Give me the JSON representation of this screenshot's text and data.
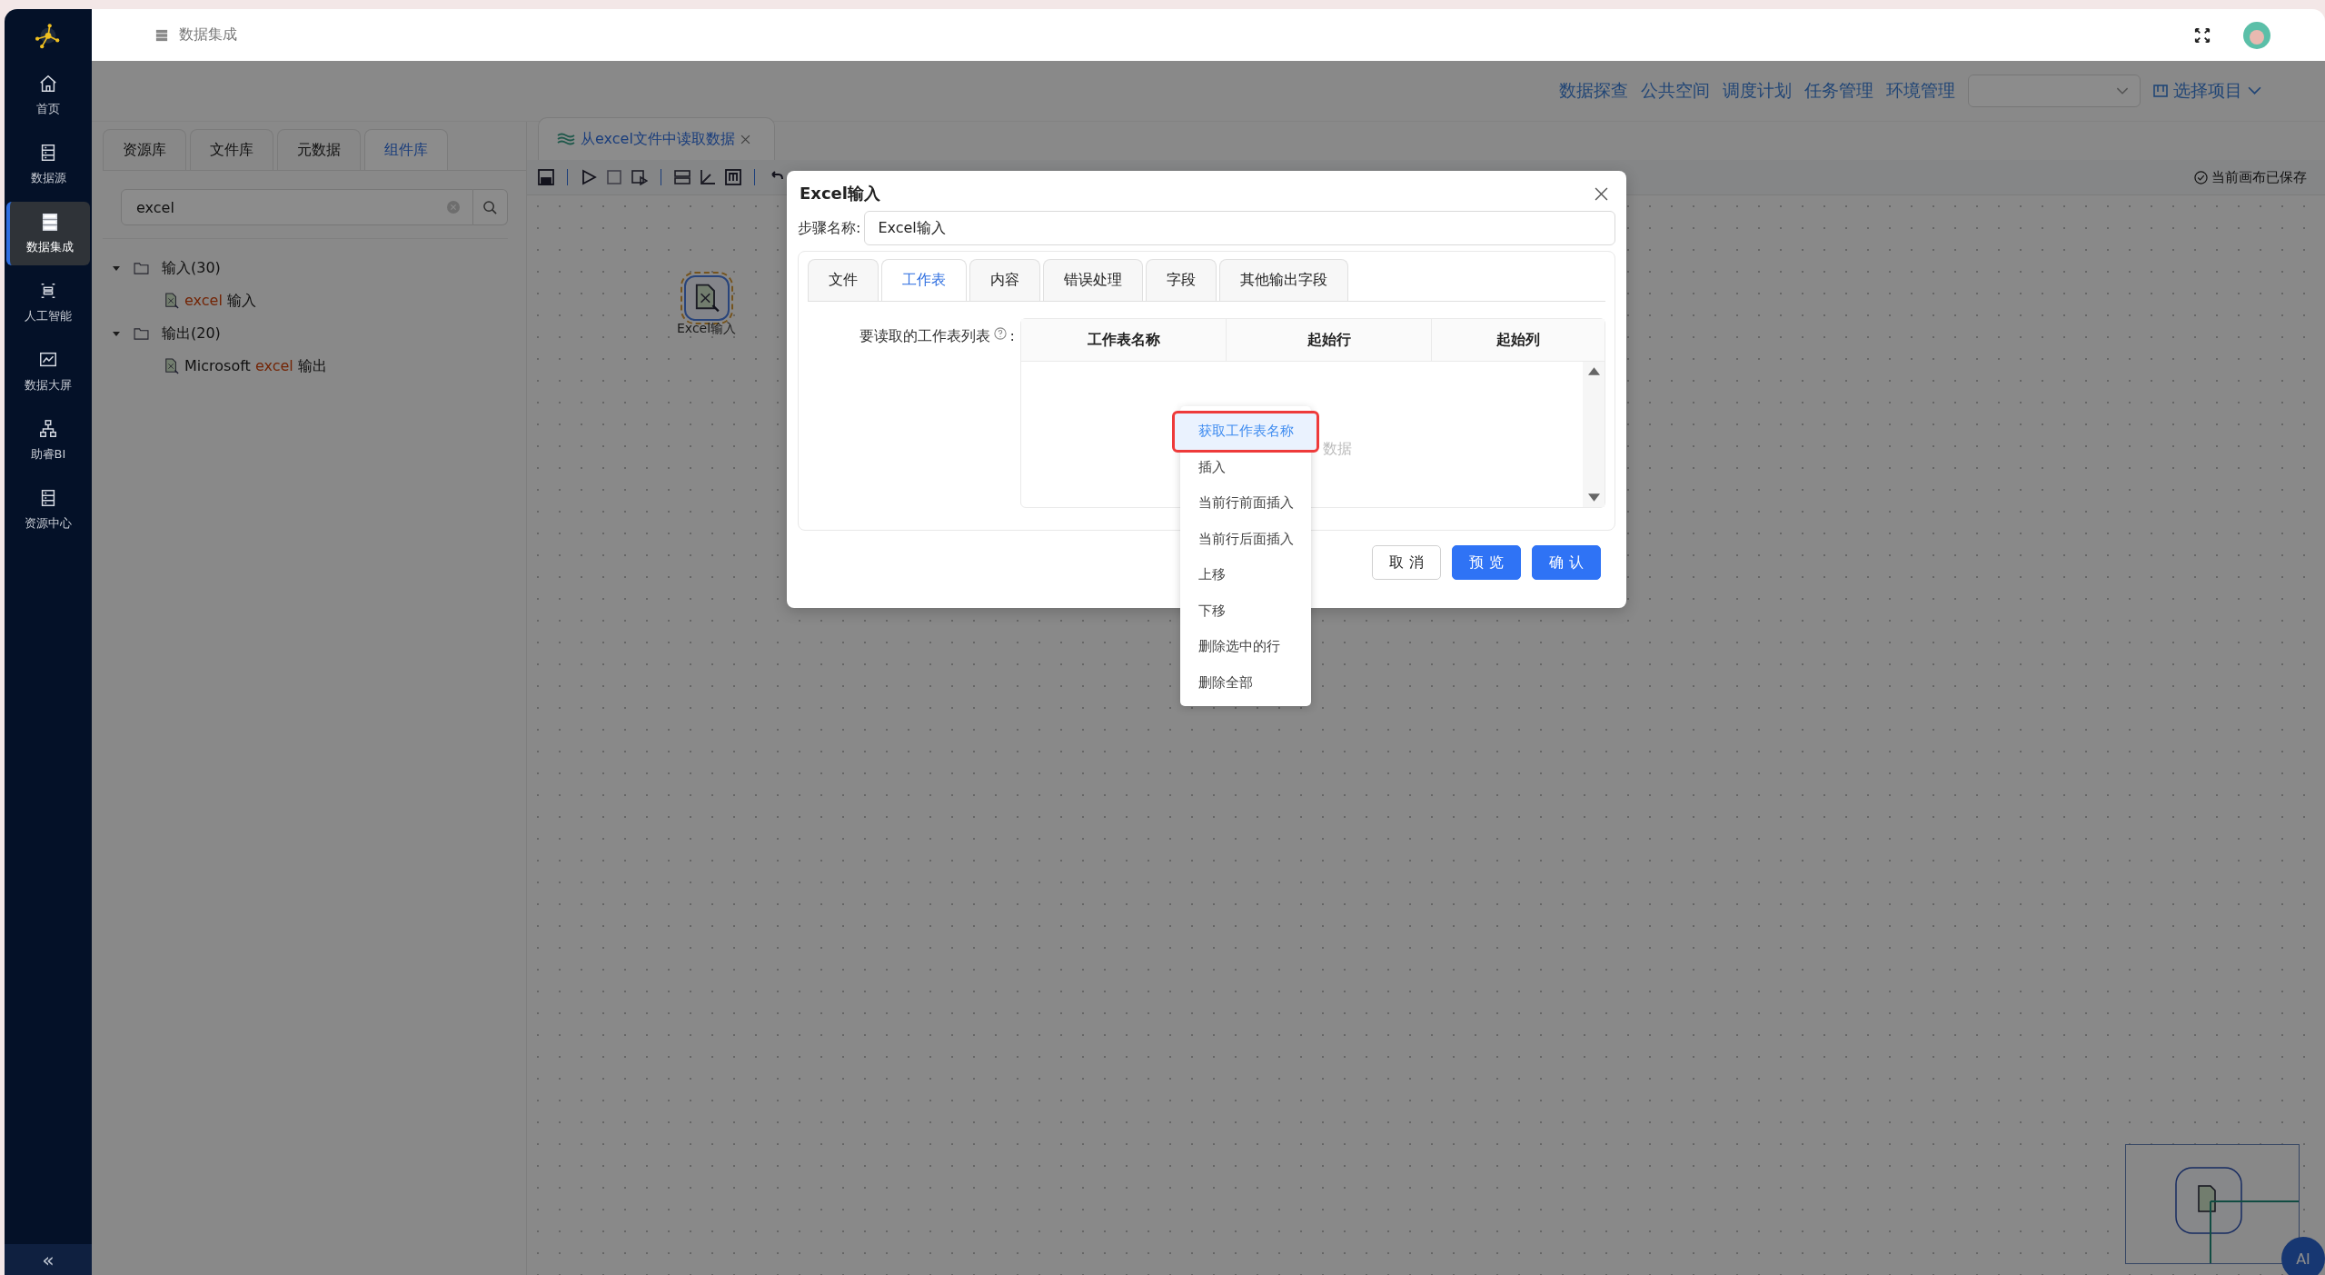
{
  "sidebar": {
    "items": [
      {
        "label": "首页",
        "selected": false
      },
      {
        "label": "数据源",
        "selected": false
      },
      {
        "label": "数据集成",
        "selected": true
      },
      {
        "label": "人工智能",
        "selected": false
      },
      {
        "label": "数据大屏",
        "selected": false
      },
      {
        "label": "助睿BI",
        "selected": false
      },
      {
        "label": "资源中心",
        "selected": false
      }
    ],
    "collapse": "«"
  },
  "header": {
    "breadcrumb": "数据集成"
  },
  "nav": {
    "links": [
      "数据探查",
      "公共空间",
      "调度计划",
      "任务管理",
      "环境管理"
    ],
    "project_select": "选择项目"
  },
  "left_panel": {
    "tabs": [
      {
        "label": "资源库",
        "selected": false
      },
      {
        "label": "文件库",
        "selected": false
      },
      {
        "label": "元数据",
        "selected": false
      },
      {
        "label": "组件库",
        "selected": true
      }
    ],
    "search": {
      "value": "excel"
    },
    "tree": [
      {
        "label": "输入(30)",
        "expanded": true,
        "children": [
          {
            "match": "excel",
            "after": " 输入"
          }
        ]
      },
      {
        "label": "输出(20)",
        "expanded": true,
        "children": [
          {
            "before": "Microsoft ",
            "match": "excel",
            "after": " 输出"
          }
        ]
      }
    ]
  },
  "editor": {
    "tab": "从excel文件中读取数据",
    "status": "当前画布已保存",
    "node": {
      "label": "Excel输入",
      "selected": true
    },
    "ai_button": "AI"
  },
  "modal": {
    "title": "Excel输入",
    "step_label": "步骤名称:",
    "step_value": "Excel输入",
    "tabs": [
      {
        "label": "文件",
        "selected": false
      },
      {
        "label": "工作表",
        "selected": true
      },
      {
        "label": "内容",
        "selected": false
      },
      {
        "label": "错误处理",
        "selected": false
      },
      {
        "label": "字段",
        "selected": false
      },
      {
        "label": "其他输出字段",
        "selected": false
      }
    ],
    "field_label": "要读取的工作表列表",
    "field_colon": ":",
    "table": {
      "columns": [
        "工作表名称",
        "起始行",
        "起始列"
      ],
      "empty_text": "数据"
    },
    "buttons": [
      {
        "label": "取 消",
        "kind": "default"
      },
      {
        "label": "预 览",
        "kind": "primary"
      },
      {
        "label": "确 认",
        "kind": "primary"
      }
    ]
  },
  "context_menu": {
    "items": [
      {
        "label": "获取工作表名称",
        "selected": true,
        "annotated": true
      },
      {
        "label": "插入",
        "selected": false,
        "annotated": false
      },
      {
        "label": "当前行前面插入",
        "selected": false,
        "annotated": false
      },
      {
        "label": "当前行后面插入",
        "selected": false,
        "annotated": false
      },
      {
        "label": "上移",
        "selected": false,
        "annotated": false
      },
      {
        "label": "下移",
        "selected": false,
        "annotated": false
      },
      {
        "label": "删除选中的行",
        "selected": false,
        "annotated": false
      },
      {
        "label": "删除全部",
        "selected": false,
        "annotated": false
      }
    ]
  }
}
